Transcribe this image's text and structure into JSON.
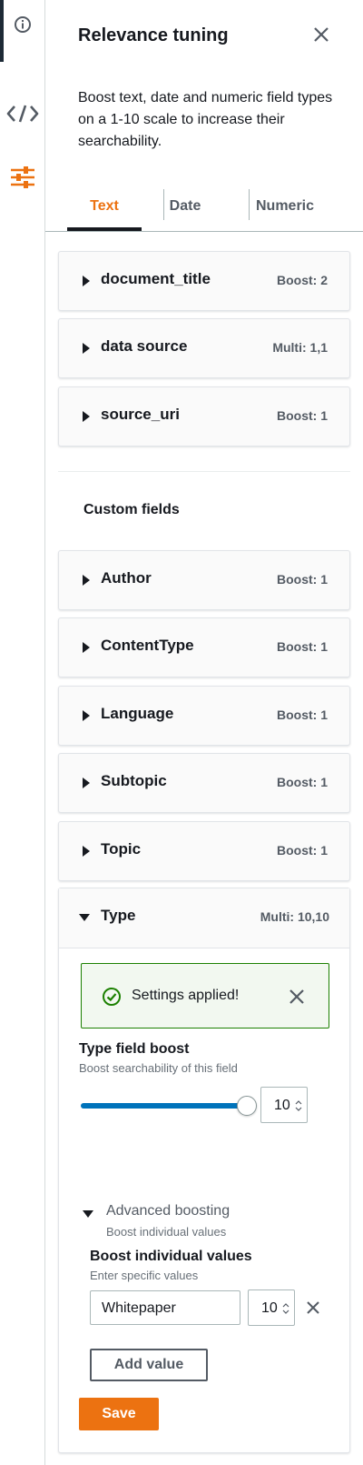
{
  "rail": {
    "icons": [
      "info-icon",
      "code-icon",
      "sliders-icon"
    ],
    "active_color": "#ec7211"
  },
  "panel": {
    "title": "Relevance tuning",
    "description": "Boost text, date and numeric field types on a 1-10 scale to increase their searchability."
  },
  "tabs": [
    {
      "label": "Text",
      "active": true
    },
    {
      "label": "Date",
      "active": false
    },
    {
      "label": "Numeric",
      "active": false
    }
  ],
  "standard_fields": [
    {
      "name": "document_title",
      "boost": "Boost: 2"
    },
    {
      "name": "data source",
      "boost": "Multi: 1,1"
    },
    {
      "name": "source_uri",
      "boost": "Boost: 1"
    }
  ],
  "custom_fields_heading": "Custom fields",
  "custom_fields": [
    {
      "name": "Author",
      "boost": "Boost: 1"
    },
    {
      "name": "ContentType",
      "boost": "Boost: 1"
    },
    {
      "name": "Language",
      "boost": "Boost: 1"
    },
    {
      "name": "Subtopic",
      "boost": "Boost: 1"
    },
    {
      "name": "Topic",
      "boost": "Boost: 1"
    }
  ],
  "expanded_field": {
    "name": "Type",
    "boost": "Multi: 10,10",
    "alert": "Settings applied!",
    "field_boost_title": "Type field boost",
    "field_boost_desc": "Boost searchability of this field",
    "field_boost_value": "10",
    "slider_level": 1.0,
    "advanced_title": "Advanced boosting",
    "advanced_desc": "Boost individual values",
    "individual_title": "Boost individual values",
    "individual_desc": "Enter specific values",
    "value_rows": [
      {
        "value": "Whitepaper",
        "boost": "10"
      }
    ],
    "add_value_label": "Add value",
    "save_label": "Save"
  },
  "colors": {
    "accent": "#ec7211",
    "success": "#1d8102",
    "slider": "#0073bb"
  }
}
